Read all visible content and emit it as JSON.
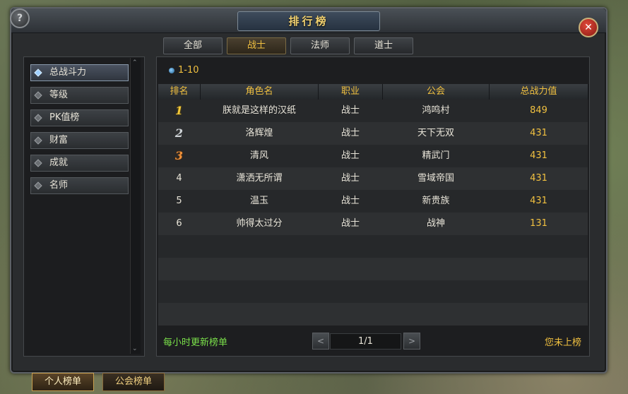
{
  "window": {
    "title": "排行榜",
    "help_label": "?",
    "close_label": "✕"
  },
  "class_tabs": [
    {
      "label": "全部",
      "active": false
    },
    {
      "label": "战士",
      "active": true
    },
    {
      "label": "法师",
      "active": false
    },
    {
      "label": "道士",
      "active": false
    }
  ],
  "sidebar": {
    "items": [
      {
        "label": "总战斗力",
        "active": true
      },
      {
        "label": "等级",
        "active": false
      },
      {
        "label": "PK值榜",
        "active": false
      },
      {
        "label": "财富",
        "active": false
      },
      {
        "label": "成就",
        "active": false
      },
      {
        "label": "名师",
        "active": false
      }
    ]
  },
  "range_label": "1-10",
  "table": {
    "headers": [
      "排名",
      "角色名",
      "职业",
      "公会",
      "总战力值"
    ],
    "rows": [
      {
        "rank": "1",
        "name": "朕就是这样的汉纸",
        "class": "战士",
        "guild": "鸿鸣村",
        "power": "849"
      },
      {
        "rank": "2",
        "name": "洛辉煌",
        "class": "战士",
        "guild": "天下无双",
        "power": "431"
      },
      {
        "rank": "3",
        "name": "清风",
        "class": "战士",
        "guild": "精武门",
        "power": "431"
      },
      {
        "rank": "4",
        "name": "潇洒无所谓",
        "class": "战士",
        "guild": "雪域帝国",
        "power": "431"
      },
      {
        "rank": "5",
        "name": "温玉",
        "class": "战士",
        "guild": "新贵族",
        "power": "431"
      },
      {
        "rank": "6",
        "name": "帅得太过分",
        "class": "战士",
        "guild": "战神",
        "power": "131"
      }
    ]
  },
  "footer": {
    "update_note": "每小时更新榜单",
    "page": "1/1",
    "prev_label": "<",
    "next_label": ">",
    "my_rank": "您未上榜"
  },
  "bottom_tabs": [
    {
      "label": "个人榜单",
      "active": true
    },
    {
      "label": "公会榜单",
      "active": false
    }
  ],
  "colors": {
    "gold": "#f0c040",
    "green": "#7ae04a",
    "panel": "#1d1e20"
  }
}
